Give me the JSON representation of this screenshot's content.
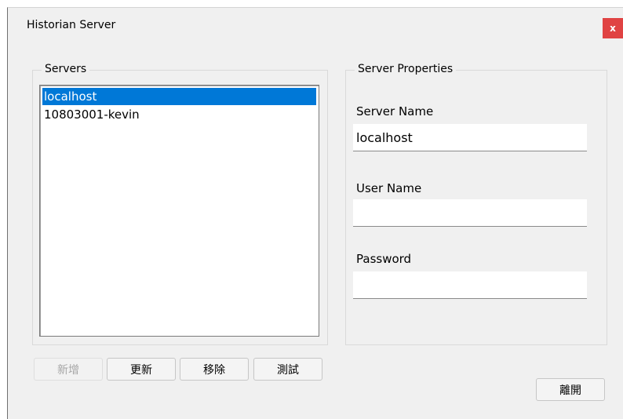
{
  "window": {
    "title": "Historian Server",
    "close_label": "x"
  },
  "servers_group": {
    "legend": "Servers",
    "items": [
      {
        "label": "localhost",
        "selected": true
      },
      {
        "label": "10803001-kevin",
        "selected": false
      }
    ]
  },
  "properties_group": {
    "legend": "Server Properties",
    "server_name_label": "Server Name",
    "server_name_value": "localhost",
    "user_name_label": "User Name",
    "user_name_value": "",
    "password_label": "Password",
    "password_value": ""
  },
  "buttons": {
    "add": "新增",
    "update": "更新",
    "remove": "移除",
    "test": "測試",
    "leave": "離開"
  },
  "colors": {
    "selection": "#0078d7",
    "close": "#e04343"
  }
}
